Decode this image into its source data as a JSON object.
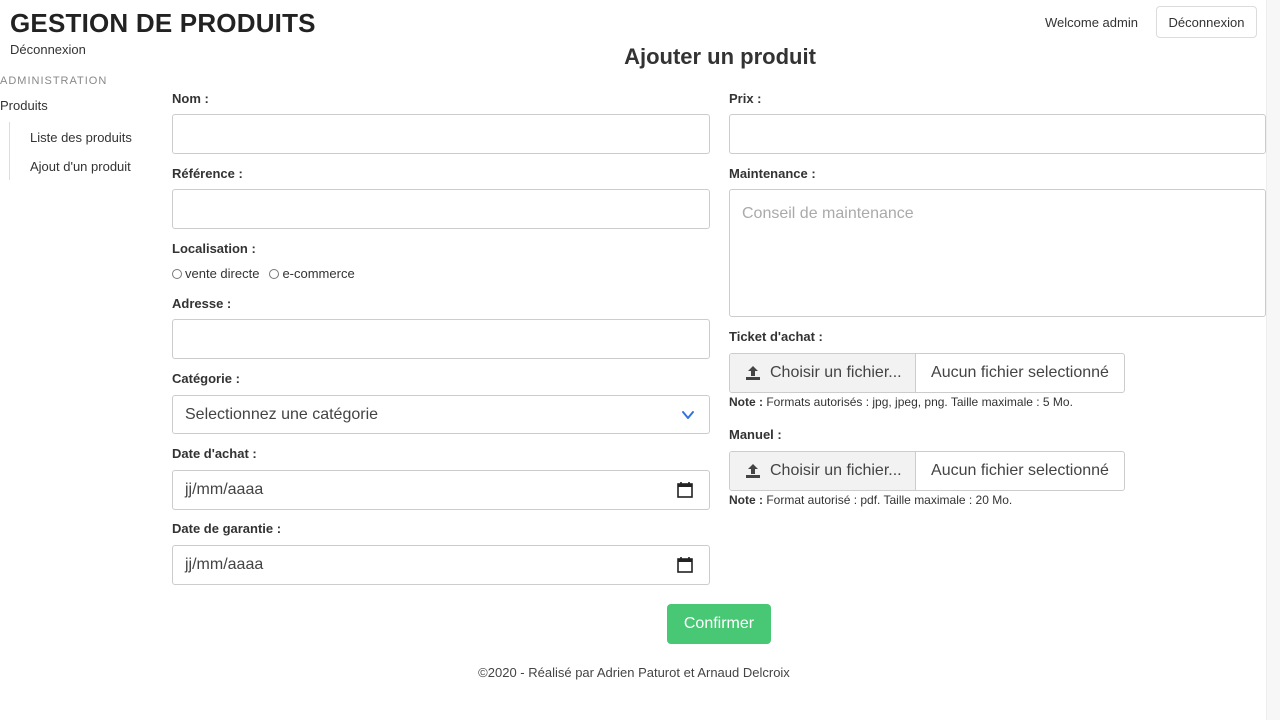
{
  "header": {
    "app_title": "GESTION DE PRODUITS",
    "top_logout": "Déconnexion",
    "welcome": "Welcome admin",
    "logout_button": "Déconnexion"
  },
  "sidebar": {
    "heading": "ADMINISTRATION",
    "section": "Produits",
    "items": [
      {
        "label": "Liste des produits"
      },
      {
        "label": "Ajout d'un produit"
      }
    ]
  },
  "page": {
    "title": "Ajouter un produit"
  },
  "form": {
    "nom": {
      "label": "Nom :",
      "value": "",
      "placeholder": ""
    },
    "prix": {
      "label": "Prix :",
      "value": "",
      "placeholder": ""
    },
    "reference": {
      "label": "Référence :",
      "value": "",
      "placeholder": ""
    },
    "maintenance": {
      "label": "Maintenance :",
      "value": "",
      "placeholder": "Conseil de maintenance"
    },
    "localisation": {
      "label": "Localisation :",
      "options": [
        "vente directe",
        "e-commerce"
      ]
    },
    "adresse": {
      "label": "Adresse :",
      "value": "",
      "placeholder": ""
    },
    "categorie": {
      "label": "Catégorie :",
      "selected": "Selectionnez une catégorie"
    },
    "date_achat": {
      "label": "Date d'achat :",
      "value": "jj/mm/aaaa"
    },
    "date_garantie": {
      "label": "Date de garantie :",
      "value": "jj/mm/aaaa"
    },
    "ticket": {
      "label": "Ticket d'achat :",
      "button": "Choisir un fichier...",
      "filename": "Aucun fichier selectionné",
      "note_label": "Note :",
      "note_text": "Formats autorisés : jpg, jpeg, png. Taille maximale : 5 Mo."
    },
    "manuel": {
      "label": "Manuel :",
      "button": "Choisir un fichier...",
      "filename": "Aucun fichier selectionné",
      "note_label": "Note :",
      "note_text": "Format autorisé : pdf. Taille maximale : 20 Mo."
    },
    "submit": "Confirmer"
  },
  "footer": {
    "text": "©2020 - Réalisé par Adrien Paturot et Arnaud Delcroix"
  },
  "colors": {
    "confirm": "#48c774",
    "chevron": "#3273dc"
  }
}
